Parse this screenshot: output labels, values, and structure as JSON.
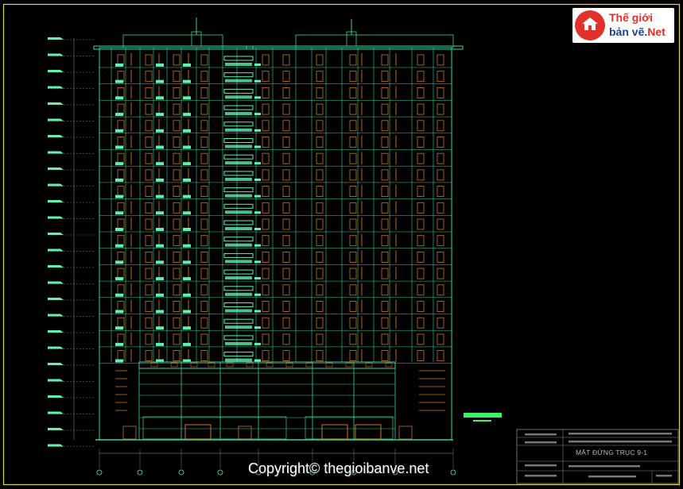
{
  "drawing": {
    "title_block": {
      "drawing_title": "MẶT ĐỨNG TRỤC 9-1"
    }
  },
  "watermark": {
    "copyright_text": "Copyright© thegioibanve.net"
  },
  "logo": {
    "line1": "Thế giới",
    "line2_main": "bản vẽ.",
    "line2_accent": "Net"
  },
  "colors": {
    "background": "#000000",
    "frame": "#d8d84a",
    "outline": "#35d39a",
    "window": "#c8781e",
    "glass": "#5ff0b4",
    "grid": "#9a9a9a",
    "logo_red": "#e0322b",
    "logo_blue": "#1f3f8f"
  },
  "icons": [
    "house-icon"
  ]
}
